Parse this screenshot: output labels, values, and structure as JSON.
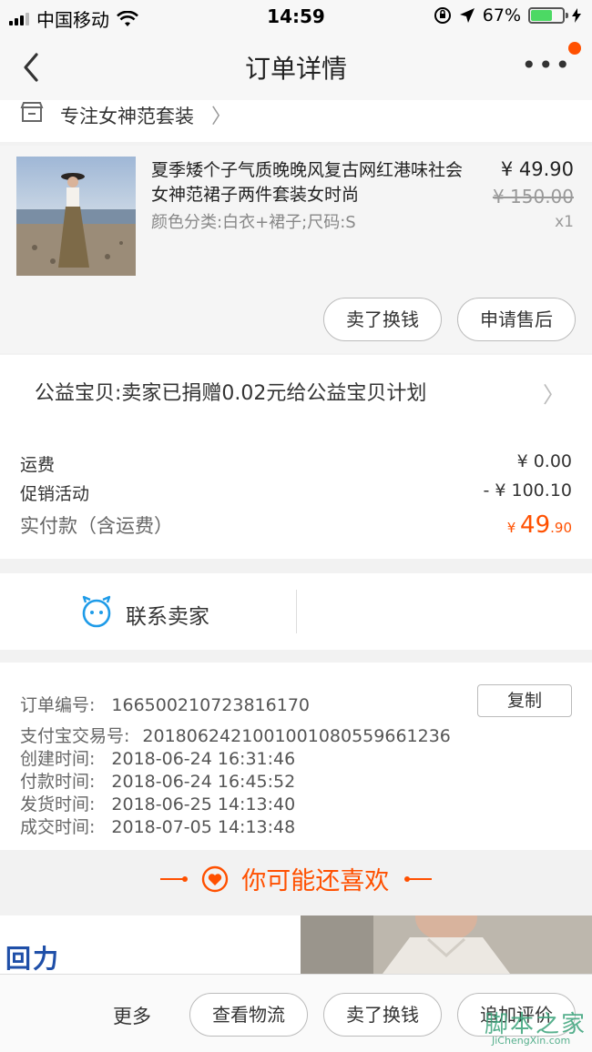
{
  "status_bar": {
    "carrier": "中国移动",
    "time": "14:59",
    "battery": "67%"
  },
  "nav": {
    "title": "订单详情"
  },
  "shop": {
    "name": "专注女神范套装"
  },
  "product": {
    "title": "夏季矮个子气质晚晚风复古网红港味社会女神范裙子两件套装女时尚",
    "spec": "颜色分类:白衣+裙子;尺码:S",
    "price": "¥ 49.90",
    "original_price": "¥ 150.00",
    "quantity": "x1",
    "btn_sell": "卖了换钱",
    "btn_after_sale": "申请售后"
  },
  "charity": {
    "text": "公益宝贝:卖家已捐赠0.02元给公益宝贝计划"
  },
  "fees": {
    "shipping_label": "运费",
    "shipping_value": "¥ 0.00",
    "promo_label": "促销活动",
    "promo_value": "- ¥ 100.10",
    "total_label": "实付款（含运费）",
    "total_symbol": "¥ ",
    "total_int": "49",
    "total_dec": ".90"
  },
  "contact": {
    "label": "联系卖家"
  },
  "order_info": {
    "copy_label": "复制",
    "lines": [
      {
        "label": "订单编号:",
        "value": "166500210723816170"
      },
      {
        "label": "支付宝交易号:",
        "value": "2018062421001001080559661236"
      },
      {
        "label": "创建时间:",
        "value": "2018-06-24 16:31:46"
      },
      {
        "label": "付款时间:",
        "value": "2018-06-24 16:45:52"
      },
      {
        "label": "发货时间:",
        "value": "2018-06-25 14:13:40"
      },
      {
        "label": "成交时间:",
        "value": "2018-07-05 14:13:48"
      }
    ]
  },
  "recommend": {
    "title": "你可能还喜欢",
    "brand_logo": "回力"
  },
  "bottom_bar": {
    "more": "更多",
    "btn_logistics": "查看物流",
    "btn_sell": "卖了换钱",
    "btn_review": "追加评价"
  },
  "watermark": {
    "top": "脚本之家",
    "bottom": "JiChengXin.com"
  },
  "colors": {
    "accent": "#ff5000",
    "battery": "#4cd964",
    "contact_icon": "#1e9be8"
  }
}
